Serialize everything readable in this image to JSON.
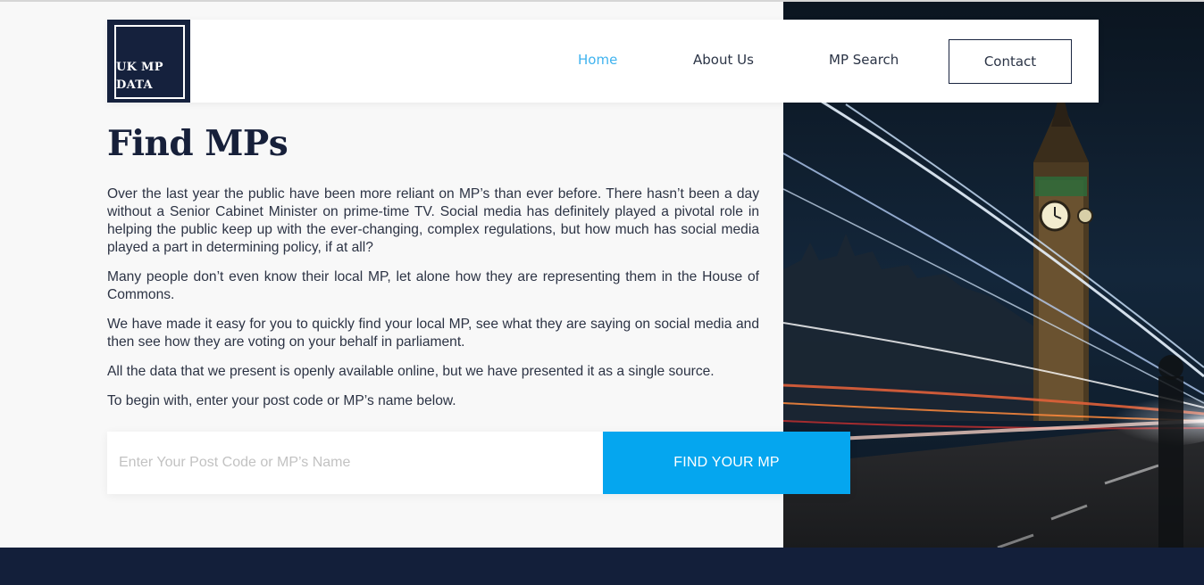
{
  "logo": {
    "line1": "UK MP",
    "line2": "DATA"
  },
  "nav": {
    "items": [
      {
        "label": "Home",
        "active": true
      },
      {
        "label": "About Us",
        "active": false
      },
      {
        "label": "MP Search",
        "active": false
      }
    ],
    "contact_label": "Contact"
  },
  "main": {
    "title": "Find MPs",
    "paragraphs": [
      "Over the last year the public have been more reliant on MP’s than ever before. There hasn’t been a day without a Senior Cabinet Minister on prime-time TV. Social media has definitely played a pivotal role in helping the public keep up with the ever-changing, complex regulations, but how much has social media played a part in determining policy, if at all?",
      "Many people don’t even know their local MP, let alone how they are representing them in the House of Commons.",
      "We have made it easy for you to quickly find your local MP, see what they are saying on social media and then see how they are voting on your behalf in parliament.",
      "All the data that we present is openly available online, but we have presented it as a single source.",
      "To begin with, enter your post code or MP’s name below."
    ]
  },
  "search": {
    "placeholder": "Enter Your Post Code or MP’s Name",
    "value": "",
    "button_label": "FIND YOUR MP"
  },
  "colors": {
    "accent": "#05a6ef",
    "active_nav": "#3fb3ef",
    "navy": "#15213d",
    "footer": "#131f3a"
  }
}
